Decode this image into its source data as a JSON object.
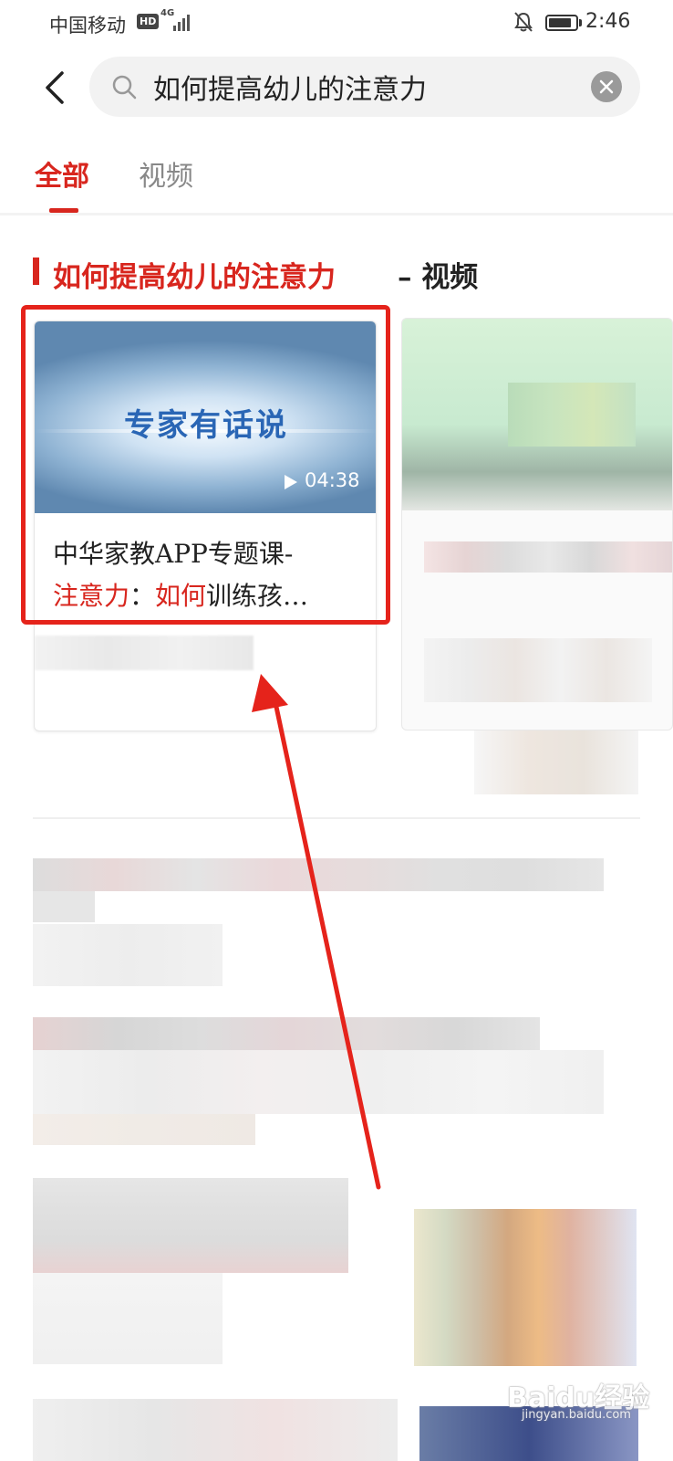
{
  "status_bar": {
    "carrier": "中国移动",
    "hd": "HD",
    "network": "4G",
    "time": "2:46"
  },
  "search": {
    "query": "如何提高幼儿的注意力"
  },
  "tabs": [
    {
      "label": "全部",
      "active": true
    },
    {
      "label": "视频",
      "active": false
    }
  ],
  "section": {
    "keyword": "如何提高幼儿的注意力",
    "suffix": "– 视频"
  },
  "video_card": {
    "thumbnail_text": "专家有话说",
    "duration": "04:38",
    "title_line1": "中华家教APP专题课-",
    "title_line2_hl1": "注意力",
    "title_line2_sep": "：",
    "title_line2_hl2": "如何",
    "title_line2_rest": "训练孩…"
  },
  "colors": {
    "accent": "#d8261e",
    "annotation": "#e5231b"
  },
  "icons": [
    "back-icon",
    "search-icon",
    "clear-icon",
    "play-icon",
    "bell-off-icon",
    "battery-icon",
    "signal-icon"
  ],
  "watermark": {
    "brand": "Baidu经验",
    "url": "jingyan.baidu.com"
  }
}
